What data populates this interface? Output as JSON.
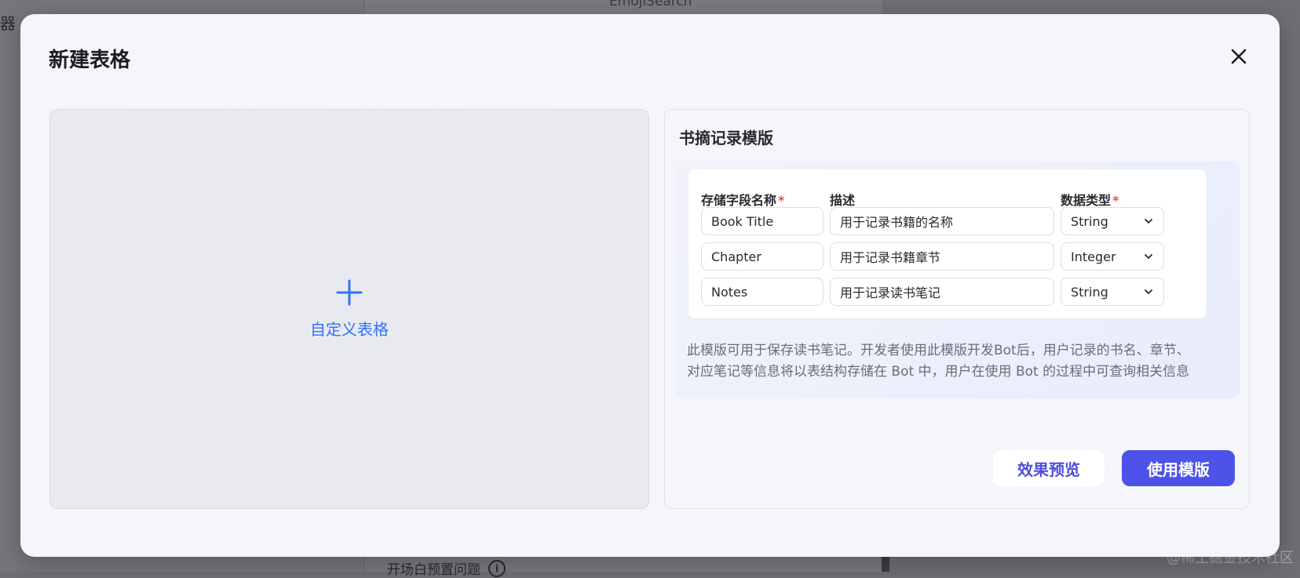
{
  "background": {
    "sidebar_fragment": "器",
    "top_text": "EmojiSearch",
    "bottom_text": "开场白预置问题",
    "info_icon": "i"
  },
  "watermark": "@稀土掘金技术社区",
  "modal": {
    "title": "新建表格",
    "close_icon": "close-icon"
  },
  "custom_table": {
    "label": "自定义表格",
    "icon": "plus-icon"
  },
  "template": {
    "title": "书摘记录模版",
    "headers": {
      "field_name": "存储字段名称",
      "description": "描述",
      "data_type": "数据类型",
      "required_mark": "*"
    },
    "rows": [
      {
        "field": "Book Title",
        "description": "用于记录书籍的名称",
        "type": "String"
      },
      {
        "field": "Chapter",
        "description": "用于记录书籍章节",
        "type": "Integer"
      },
      {
        "field": "Notes",
        "description": "用于记录读书笔记",
        "type": "String"
      }
    ],
    "description_line1": "此模版可用于保存读书笔记。开发者使用此模版开发Bot后，用户记录的书名、章节、",
    "description_line2": "对应笔记等信息将以表结构存储在 Bot 中，用户在使用 Bot 的过程中可查询相关信息"
  },
  "buttons": {
    "preview": "效果预览",
    "use_template": "使用模版"
  },
  "colors": {
    "accent": "#3370ff",
    "primary_button": "#4d53e8",
    "required": "#f54a45"
  }
}
